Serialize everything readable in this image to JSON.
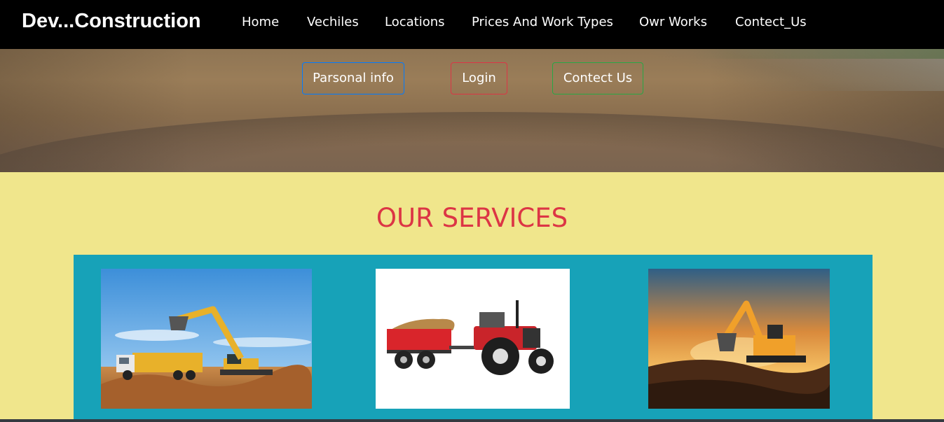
{
  "navbar": {
    "brand": "Dev...Construction",
    "links": [
      {
        "label": "Home"
      },
      {
        "label": "Vechiles"
      },
      {
        "label": "Locations"
      },
      {
        "label": "Prices And Work Types"
      },
      {
        "label": "Owr Works"
      },
      {
        "label": "Contect_Us"
      }
    ]
  },
  "hero": {
    "buttons": [
      {
        "label": "Parsonal info",
        "border_color": "#007bff"
      },
      {
        "label": "Login",
        "border_color": "#dc3545"
      },
      {
        "label": "Contect Us",
        "border_color": "#28a745"
      }
    ]
  },
  "services": {
    "title": "OUR SERVICES",
    "title_color": "#dc3545",
    "panel_color": "#17a2b8",
    "background_color": "#f0e68c",
    "cards": [
      {
        "image": "excavator-loading-dump-truck"
      },
      {
        "image": "red-tractor-with-trailer"
      },
      {
        "image": "excavator-at-sunset"
      }
    ]
  }
}
